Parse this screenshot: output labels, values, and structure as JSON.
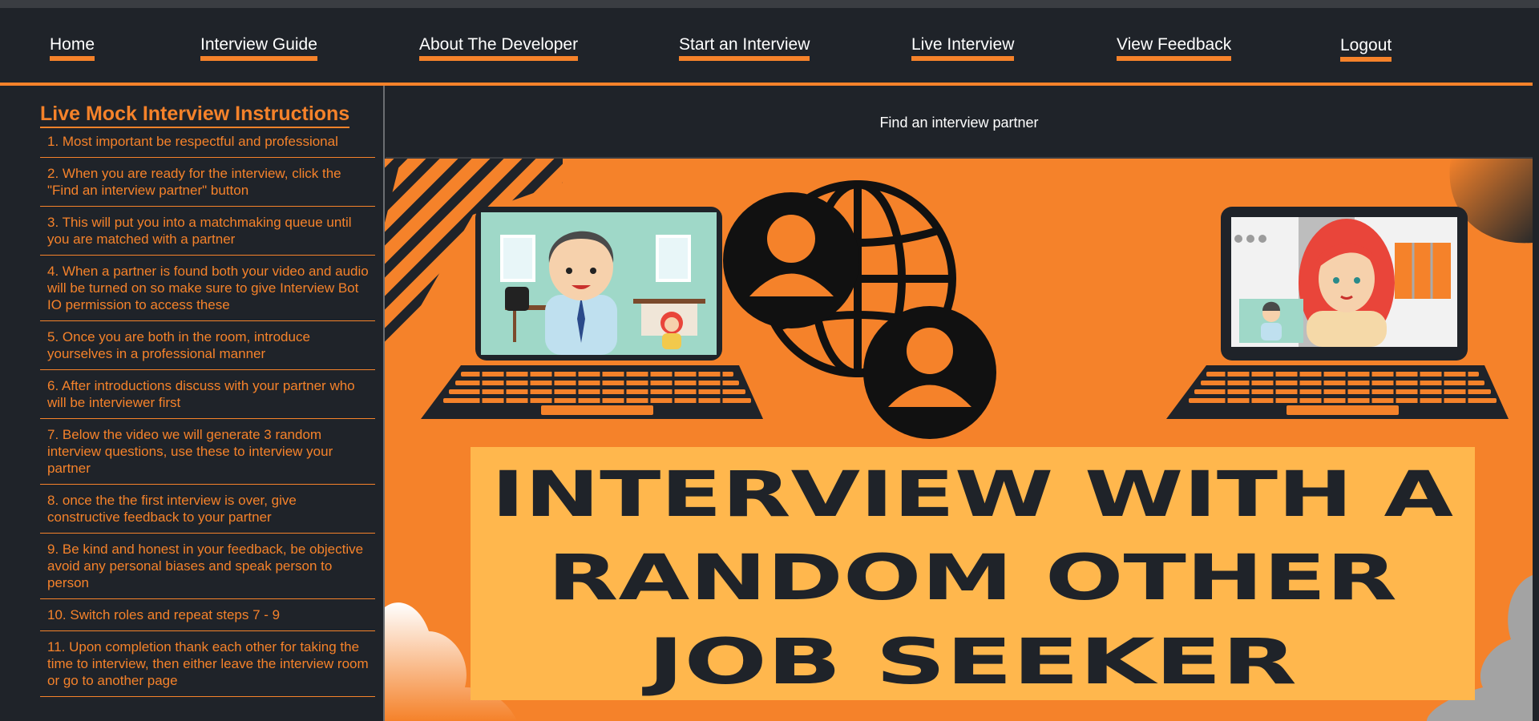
{
  "nav": {
    "items": [
      {
        "label": "Home"
      },
      {
        "label": "Interview Guide"
      },
      {
        "label": "About The Developer"
      },
      {
        "label": "Start an Interview"
      },
      {
        "label": "Live Interview"
      },
      {
        "label": "View Feedback"
      },
      {
        "label": "Logout"
      }
    ]
  },
  "sidebar": {
    "title": "Live Mock Interview Instructions",
    "steps": [
      "1. Most important be respectful and professional",
      "2. When you are ready for the interview, click the \"Find an interview partner\" button",
      "3. This will put you into a matchmaking queue until you are matched with a partner",
      "4. When a partner is found both your video and audio will be turned on so make sure to give Interview Bot IO permission to access these",
      "5. Once you are both in the room, introduce yourselves in a professional manner",
      "6. After introductions discuss with your partner who will be interviewer first",
      "7. Below the video we will generate 3 random interview questions, use these to interview your partner",
      "8. once the the first interview is over, give constructive feedback to your partner",
      "9. Be kind and honest in your feedback, be objective avoid any personal biases and speak person to person",
      "10. Switch roles and repeat steps 7 - 9",
      "11. Upon completion thank each other for taking the time to interview, then either leave the interview room or go to another page"
    ]
  },
  "main": {
    "find_button_label": "Find an interview partner"
  },
  "hero": {
    "headline_lines": [
      "INTERVIEW WITH A",
      "RANDOM OTHER",
      "JOB SEEKER"
    ]
  },
  "colors": {
    "accent": "#f5822a",
    "background": "#1f2329",
    "banner": "#ffb74d",
    "text": "#ffffff"
  }
}
